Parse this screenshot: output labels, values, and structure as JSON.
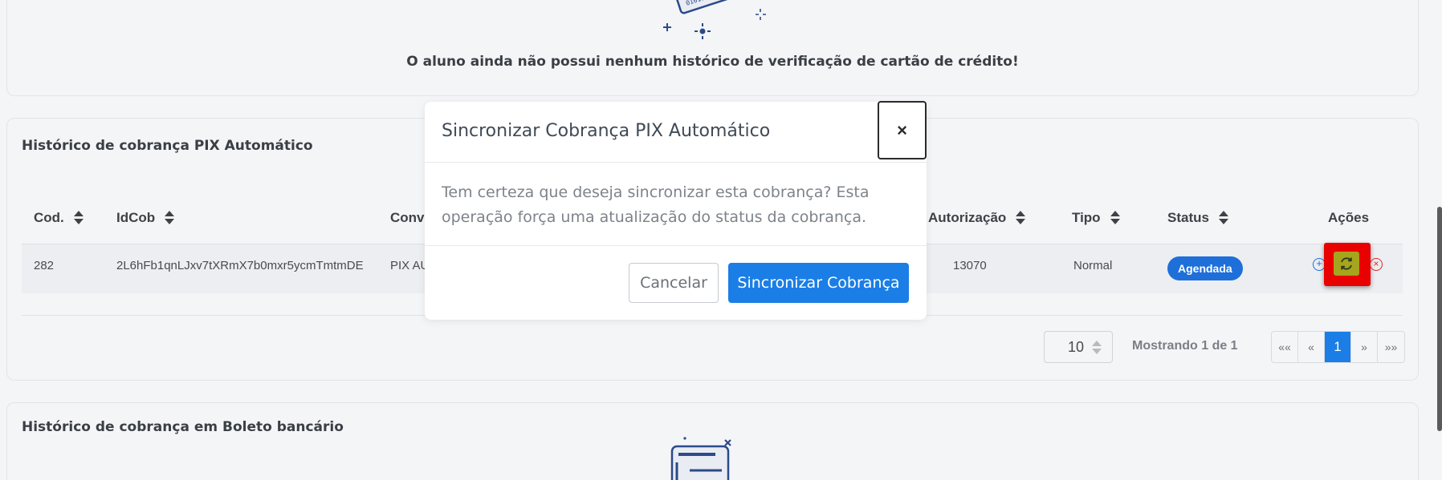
{
  "credit_card_history": {
    "empty_message": "O aluno ainda não possui nenhum histórico de verificação de cartão de crédito!"
  },
  "pix_history": {
    "title": "Histórico de cobrança PIX Automático",
    "columns": {
      "cod": "Cod.",
      "idcob": "IdCob",
      "conv": "Conv",
      "autorizacao": "Autorização",
      "tipo": "Tipo",
      "status": "Status",
      "acoes": "Ações"
    },
    "rows": [
      {
        "cod": "282",
        "idcob": "2L6hFb1qnLJxv7tXRmX7b0mxr5ycmTmtmDE",
        "conv": "PIX AU",
        "autorizacao": "13070",
        "tipo": "Normal",
        "status": "Agendada"
      }
    ],
    "page_size": "10",
    "showing": "Mostrando 1 de 1",
    "pager": {
      "first": "««",
      "prev": "«",
      "current": "1",
      "next": "»",
      "last": "»»"
    }
  },
  "boleto_history": {
    "title": "Histórico de cobrança em Boleto bancário"
  },
  "modal": {
    "title": "Sincronizar Cobrança PIX Automático",
    "close": "×",
    "body": "Tem certeza que deseja sincronizar esta cobrança? Esta operação força uma atualização do status da cobrança.",
    "cancel_label": "Cancelar",
    "confirm_label": "Sincronizar Cobrança"
  },
  "colors": {
    "primary": "#1a7ee6",
    "badge": "#1e6fd9",
    "highlight": "#e90000"
  }
}
